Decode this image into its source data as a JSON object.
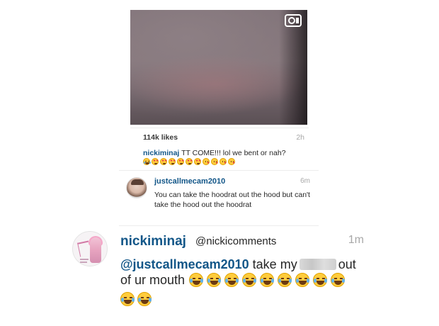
{
  "post": {
    "likes": "114k likes",
    "time": "2h",
    "caption_user": "nickiminaj",
    "caption_text": " TT COME!!! lol we bent or nah?",
    "caption_emojis": [
      "laugh-cry",
      "heart-eyes",
      "heart-eyes",
      "heart-eyes",
      "heart-eyes",
      "heart-eyes",
      "heart-eyes",
      "kiss",
      "kiss",
      "kiss",
      "kiss"
    ]
  },
  "comment1": {
    "user": "justcallmecam2010",
    "time": "6m",
    "text": "You can take the hoodrat out the hood but can't take the hood out the hoodrat"
  },
  "comment2": {
    "user": "nickiminaj",
    "mention": "@nickicomments",
    "time": "1m",
    "reply_mention": "@justcallmecam2010",
    "text_before": " take my",
    "text_after": "out",
    "text_line2": "of ur mouth",
    "emojis_line2": 9,
    "emojis_line3": 2
  },
  "colors": {
    "username_blue": "#125688",
    "timestamp_gray": "#a8a8a8",
    "emoji_yellow": "#ffcc3d"
  }
}
